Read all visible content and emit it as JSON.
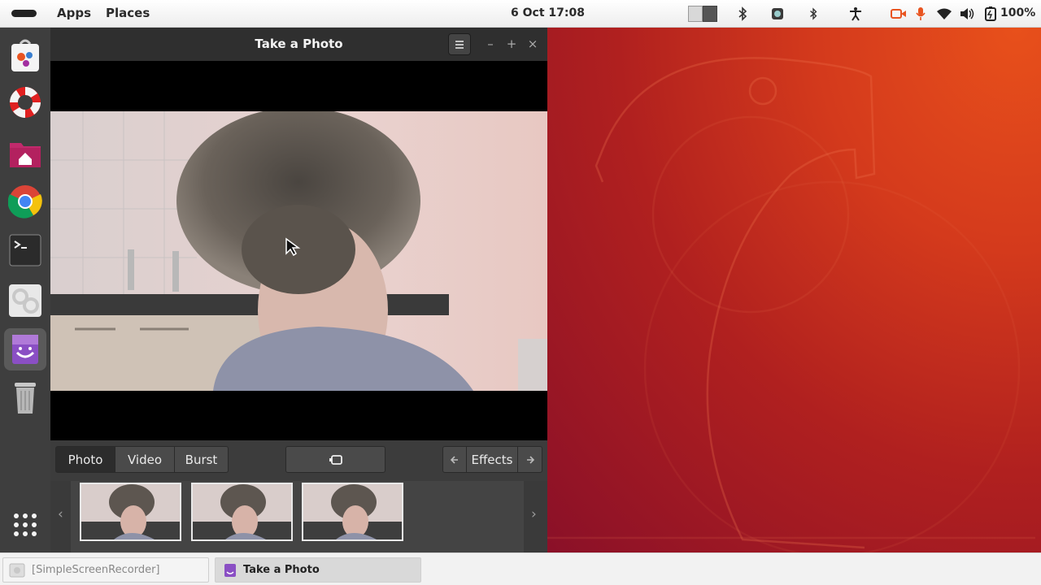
{
  "topbar": {
    "apps_label": "Apps",
    "places_label": "Places",
    "clock": "6 Oct  17:08",
    "battery": "100%"
  },
  "dock": {
    "items": [
      {
        "name": "software-center-icon"
      },
      {
        "name": "help-icon"
      },
      {
        "name": "home-folder-icon"
      },
      {
        "name": "chrome-icon"
      },
      {
        "name": "terminal-icon"
      },
      {
        "name": "settings-icon"
      },
      {
        "name": "cheese-icon",
        "active": true
      },
      {
        "name": "trash-icon"
      }
    ],
    "show_apps": "apps-grid-icon"
  },
  "window": {
    "title": "Take a Photo",
    "modes": [
      "Photo",
      "Video",
      "Burst"
    ],
    "active_mode": "Photo",
    "effects_label": "Effects",
    "thumbnail_count": 3
  },
  "taskbar": {
    "tasks": [
      {
        "label": "[SimpleScreenRecorder]",
        "active": false
      },
      {
        "label": "Take a Photo",
        "active": true
      }
    ]
  },
  "colors": {
    "accent_orange": "#e95420",
    "wallpaper_deep": "#8a1028",
    "window_dark": "#2f2f2f"
  }
}
